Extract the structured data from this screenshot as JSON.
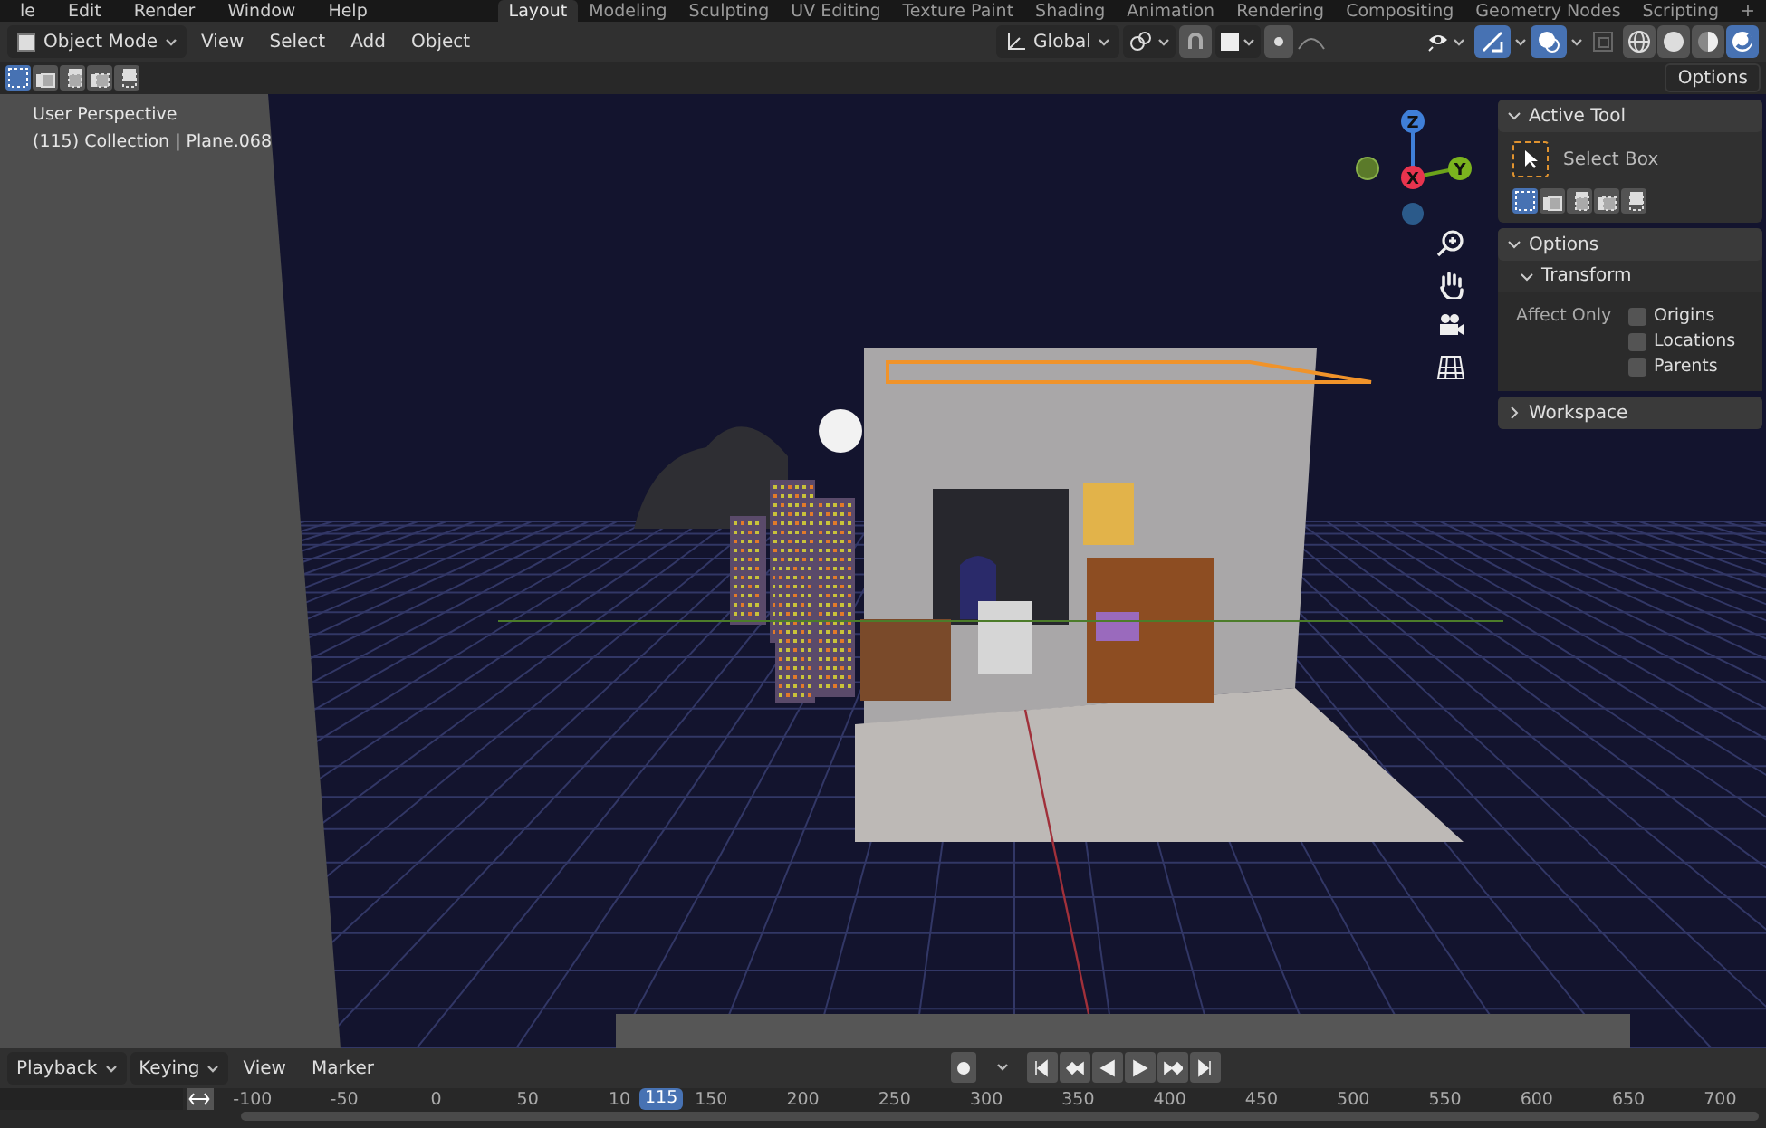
{
  "menu_bar": {
    "menus": [
      "le",
      "Edit",
      "Render",
      "Window",
      "Help"
    ],
    "workspaces": [
      {
        "label": "Layout",
        "selected": true
      },
      {
        "label": "Modeling",
        "selected": false
      },
      {
        "label": "Sculpting",
        "selected": false
      },
      {
        "label": "UV Editing",
        "selected": false
      },
      {
        "label": "Texture Paint",
        "selected": false
      },
      {
        "label": "Shading",
        "selected": false
      },
      {
        "label": "Animation",
        "selected": false
      },
      {
        "label": "Rendering",
        "selected": false
      },
      {
        "label": "Compositing",
        "selected": false
      },
      {
        "label": "Geometry Nodes",
        "selected": false
      },
      {
        "label": "Scripting",
        "selected": false
      }
    ],
    "add_tab": "+"
  },
  "header": {
    "mode": "Object Mode",
    "menus": [
      "View",
      "Select",
      "Add",
      "Object"
    ],
    "orientation": "Global",
    "shading_modes": [
      {
        "selected": false
      },
      {
        "selected": false
      },
      {
        "selected": false
      },
      {
        "selected": true
      }
    ]
  },
  "tool_settings": {
    "select_modes": [
      {
        "selected": true
      },
      {
        "selected": false
      },
      {
        "selected": false
      },
      {
        "selected": false
      },
      {
        "selected": false
      }
    ],
    "options_button": "Options"
  },
  "viewport": {
    "info_lines": [
      "User Perspective",
      "(115) Collection | Plane.068"
    ],
    "gizmo_axes": [
      "Z",
      "X",
      "Y"
    ]
  },
  "sidebar": {
    "active_tool": {
      "title": "Active Tool",
      "expanded": true,
      "tool": "Select Box",
      "modes": [
        {
          "selected": true
        },
        {
          "selected": false
        },
        {
          "selected": false
        },
        {
          "selected": false
        },
        {
          "selected": false
        }
      ]
    },
    "options": {
      "title": "Options",
      "expanded": true,
      "transform": {
        "title": "Transform",
        "expanded": true,
        "affect_only": "Affect Only",
        "checkboxes": [
          {
            "label": "Origins",
            "checked": false
          },
          {
            "label": "Locations",
            "checked": false
          },
          {
            "label": "Parents",
            "checked": false
          }
        ]
      }
    },
    "workspace": {
      "title": "Workspace",
      "expanded": false
    }
  },
  "timeline": {
    "menus": [
      {
        "label": "Playback",
        "kind": "dropdown"
      },
      {
        "label": "Keying",
        "kind": "dropdown"
      },
      {
        "label": "View",
        "kind": "plain"
      },
      {
        "label": "Marker",
        "kind": "plain"
      }
    ],
    "ruler_ticks": [
      "-100",
      "-50",
      "0",
      "50",
      "10",
      "150",
      "200",
      "250",
      "300",
      "350",
      "400",
      "450",
      "500",
      "550",
      "600",
      "650",
      "700"
    ],
    "current_frame": "115"
  }
}
